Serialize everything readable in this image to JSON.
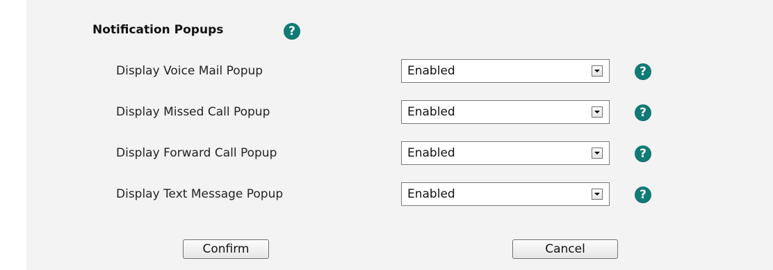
{
  "section": {
    "title": "Notification Popups",
    "help_glyph": "?"
  },
  "rows": [
    {
      "label": "Display Voice Mail Popup",
      "value": "Enabled"
    },
    {
      "label": "Display Missed Call Popup",
      "value": "Enabled"
    },
    {
      "label": "Display Forward Call Popup",
      "value": "Enabled"
    },
    {
      "label": "Display Text Message Popup",
      "value": "Enabled"
    }
  ],
  "help_glyph": "?",
  "buttons": {
    "confirm": "Confirm",
    "cancel": "Cancel"
  },
  "colors": {
    "help_icon": "#107a76",
    "panel_background": "#f3f3f3"
  },
  "icons": {
    "help": "question-mark-circle-icon",
    "dropdown": "chevron-down-icon"
  }
}
